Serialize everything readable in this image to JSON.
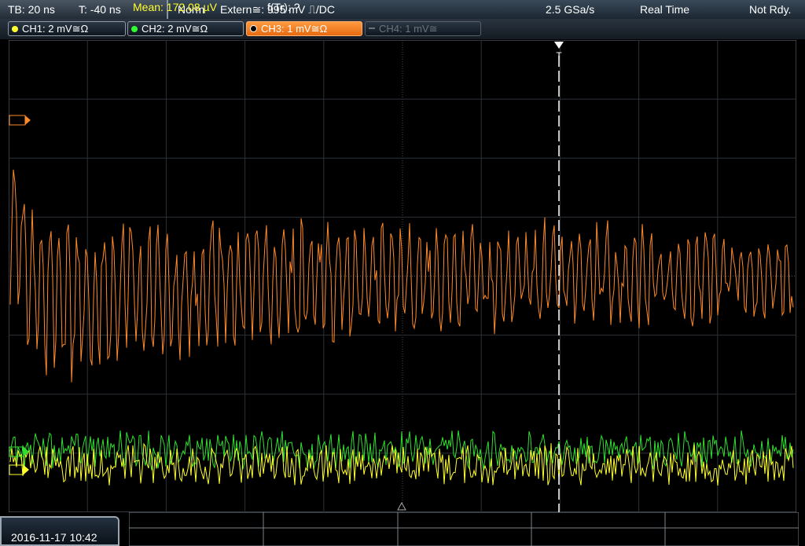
{
  "topbar": {
    "timebase": "TB: 20 ns",
    "trigger_time": "T: -40 ns",
    "mode": "Norm",
    "trigger_source": "Extern≅: 995 mV ⎍/DC",
    "sample_rate": "2.5 GSa/s",
    "acq_mode": "Real Time",
    "status": "Not Rdy."
  },
  "channels": [
    {
      "label": "CH1: 2 mV≅Ω",
      "color": "#ffff30",
      "state": "on"
    },
    {
      "label": "CH2: 2 mV≅Ω",
      "color": "#30ff30",
      "state": "on"
    },
    {
      "label": "CH3: 1 mV≅Ω",
      "color": "#ff8a2a",
      "state": "active"
    },
    {
      "label": "CH4: 1 mV≅",
      "color": "#7a838c",
      "state": "off"
    }
  ],
  "markers": {
    "trigger_label": "T"
  },
  "measurements": {
    "mean": "Mean: 172.08 µV",
    "freq": "f(Tr): ?",
    "mean_color": "#ffff30"
  },
  "datetime": "2016-11-17 10:42"
}
